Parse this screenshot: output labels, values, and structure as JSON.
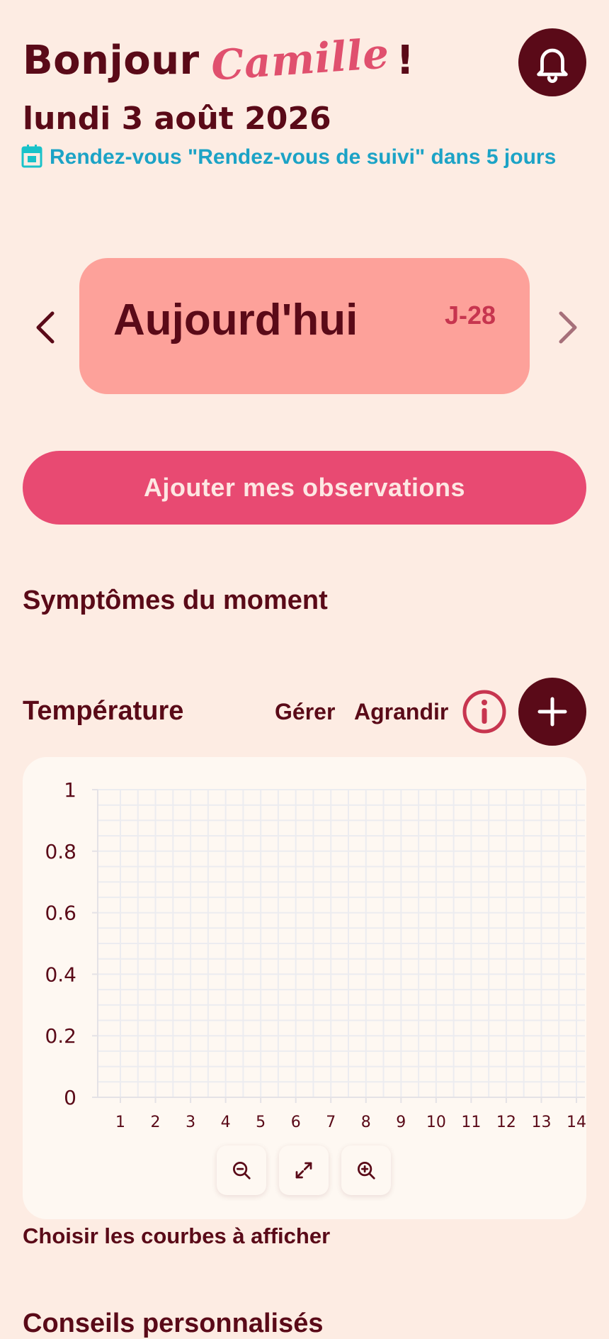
{
  "header": {
    "greeting": "Bonjour",
    "name": "Camille",
    "exclamation": "!",
    "date": "lundi 3 août 2026",
    "appointment": "Rendez-vous \"Rendez-vous de suivi\" dans 5 jours",
    "notification_icon": "bell-icon",
    "calendar_icon": "calendar-icon"
  },
  "day_selector": {
    "label": "Aujourd'hui",
    "countdown": "J-28",
    "prev_icon": "chevron-left-icon",
    "next_icon": "chevron-right-icon"
  },
  "add_observations": "Ajouter mes observations",
  "symptoms_title": "Symptômes du moment",
  "temperature": {
    "title": "Température",
    "manage": "Gérer",
    "expand": "Agrandir",
    "info_icon": "info-icon",
    "add_icon": "plus-icon"
  },
  "chart_data": {
    "type": "line",
    "title": "",
    "xlabel": "",
    "ylabel": "",
    "x": [
      1,
      2,
      3,
      4,
      5,
      6,
      7,
      8,
      9,
      10,
      11,
      12,
      13,
      14
    ],
    "y_ticks": [
      "1",
      "0.8",
      "0.6",
      "0.4",
      "0.2",
      "0"
    ],
    "x_ticks": [
      "1",
      "2",
      "3",
      "4",
      "5",
      "6",
      "7",
      "8",
      "9",
      "10",
      "11",
      "12",
      "13",
      "14"
    ],
    "ylim": [
      0,
      1
    ],
    "xlim": [
      1,
      14
    ],
    "series": [],
    "grid": true
  },
  "zoom_controls": {
    "zoom_out_icon": "zoom-out-icon",
    "fit_icon": "expand-icon",
    "zoom_in_icon": "zoom-in-icon"
  },
  "choose_curves": "Choisir les courbes à afficher",
  "next_section": "Conseils personnalisés"
}
